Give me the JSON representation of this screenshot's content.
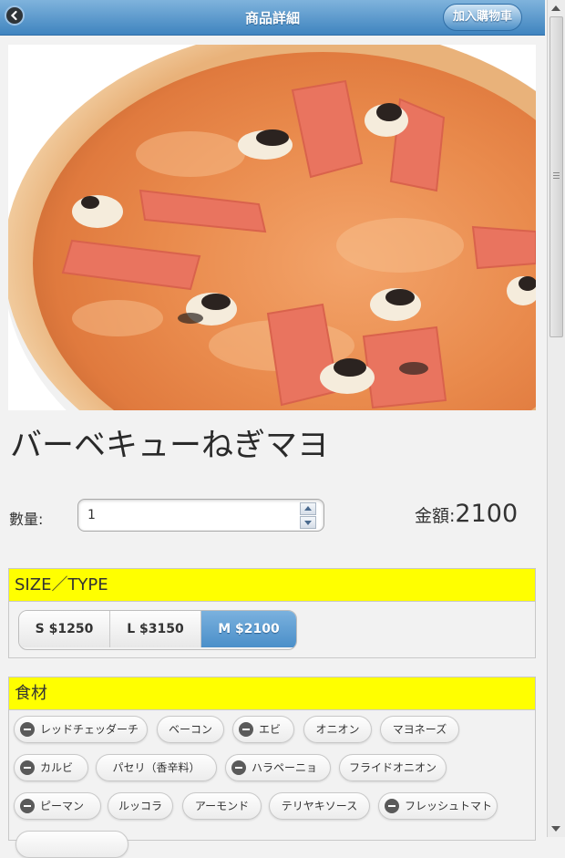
{
  "header": {
    "title": "商品詳細",
    "cart_button": "加入購物車"
  },
  "product": {
    "name": "バーベキューねぎマヨ",
    "quantity_label": "數量:",
    "quantity_value": "1",
    "total_label": "金額:",
    "total_value": "2100"
  },
  "size": {
    "heading": "SIZE／TYPE",
    "options": [
      "S $1250",
      "L $3150",
      "M $2100"
    ],
    "selected": "M $2100"
  },
  "ingredients": {
    "heading": "食材",
    "items": [
      {
        "label": "レッドチェッダーチ",
        "removable": true
      },
      {
        "label": "ベーコン",
        "removable": false
      },
      {
        "label": "エビ",
        "removable": true
      },
      {
        "label": "オニオン",
        "removable": false
      },
      {
        "label": "マヨネーズ",
        "removable": false
      },
      {
        "label": "カルビ",
        "removable": true
      },
      {
        "label": "パセリ（香辛料）",
        "removable": false
      },
      {
        "label": "ハラペーニョ",
        "removable": true
      },
      {
        "label": "フライドオニオン",
        "removable": false
      },
      {
        "label": "ピーマン",
        "removable": true
      },
      {
        "label": "ルッコラ",
        "removable": false
      },
      {
        "label": "アーモンド",
        "removable": false
      },
      {
        "label": "テリヤキソース",
        "removable": false
      },
      {
        "label": "フレッシュトマト",
        "removable": true
      }
    ]
  },
  "colors": {
    "header": "#4a8cc4",
    "accent": "#5a9bd2",
    "panel_heading": "#ffff00"
  }
}
